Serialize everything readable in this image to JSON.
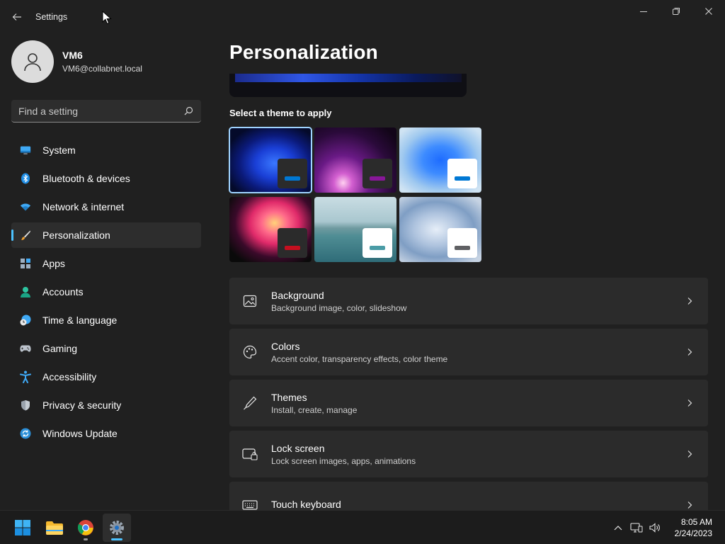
{
  "window": {
    "title": "Settings"
  },
  "profile": {
    "name": "VM6",
    "email": "VM6@collabnet.local"
  },
  "search": {
    "placeholder": "Find a setting"
  },
  "sidebar": {
    "items": [
      {
        "label": "System",
        "icon": "monitor-icon"
      },
      {
        "label": "Bluetooth & devices",
        "icon": "bluetooth-icon"
      },
      {
        "label": "Network & internet",
        "icon": "wifi-icon"
      },
      {
        "label": "Personalization",
        "icon": "brush-icon",
        "active": true
      },
      {
        "label": "Apps",
        "icon": "apps-icon"
      },
      {
        "label": "Accounts",
        "icon": "person-icon"
      },
      {
        "label": "Time & language",
        "icon": "clock-globe-icon"
      },
      {
        "label": "Gaming",
        "icon": "gamepad-icon"
      },
      {
        "label": "Accessibility",
        "icon": "accessibility-icon"
      },
      {
        "label": "Privacy & security",
        "icon": "shield-icon"
      },
      {
        "label": "Windows Update",
        "icon": "update-icon"
      }
    ]
  },
  "main": {
    "title": "Personalization",
    "themes_heading": "Select a theme to apply",
    "themes": [
      {
        "accent": "#0078d4",
        "box": "#2b2b2b",
        "selected": true
      },
      {
        "accent": "#881798",
        "box": "#2b2b2b"
      },
      {
        "accent": "#0078d4",
        "box": "#ffffff"
      },
      {
        "accent": "#c50f1f",
        "box": "#2b2b2b"
      },
      {
        "accent": "#4a9ca6",
        "box": "#ffffff"
      },
      {
        "accent": "#5f6063",
        "box": "#ffffff"
      }
    ],
    "cards": [
      {
        "title": "Background",
        "subtitle": "Background image, color, slideshow",
        "icon": "image-icon"
      },
      {
        "title": "Colors",
        "subtitle": "Accent color, transparency effects, color theme",
        "icon": "palette-icon"
      },
      {
        "title": "Themes",
        "subtitle": "Install, create, manage",
        "icon": "pen-icon"
      },
      {
        "title": "Lock screen",
        "subtitle": "Lock screen images, apps, animations",
        "icon": "lock-screen-icon"
      },
      {
        "title": "Touch keyboard",
        "subtitle": "",
        "icon": "keyboard-icon"
      }
    ]
  },
  "taskbar": {
    "apps": [
      "start-icon",
      "file-explorer-icon",
      "chrome-icon",
      "settings-gear-icon"
    ],
    "clock": {
      "time": "8:05 AM",
      "date": "2/24/2023"
    }
  }
}
